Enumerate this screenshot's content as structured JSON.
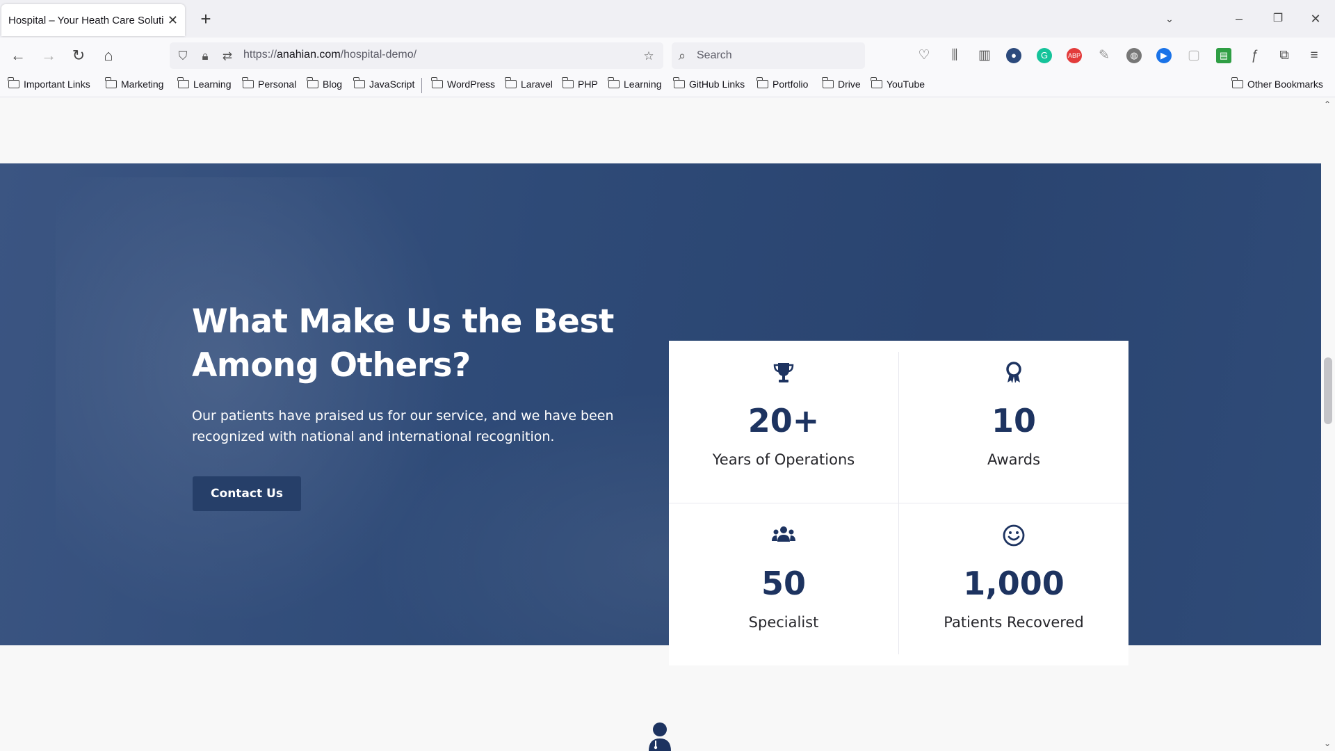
{
  "browser": {
    "tab_title": "Hospital – Your Heath Care Solution",
    "url_prefix": "https://",
    "url_domain": "anahian.com",
    "url_path": "/hospital-demo/",
    "search_placeholder": "Search",
    "bookmarks": [
      "Important Links",
      "Marketing",
      "Learning",
      "Personal",
      "Blog",
      "JavaScript",
      "WordPress",
      "Laravel",
      "PHP",
      "Learning",
      "GitHub Links",
      "Portfolio",
      "Drive",
      "YouTube"
    ],
    "other_bookmarks": "Other Bookmarks"
  },
  "hero": {
    "title": "What Make Us the Best Among Others?",
    "description": "Our patients have praised us for our service, and we have been recognized with national and international recognition.",
    "cta_label": "Contact Us"
  },
  "stats": [
    {
      "icon": "trophy-icon",
      "value": "20+",
      "label": "Years of Operations"
    },
    {
      "icon": "award-icon",
      "value": "10",
      "label": "Awards"
    },
    {
      "icon": "users-icon",
      "value": "50",
      "label": "Specialist"
    },
    {
      "icon": "smile-icon",
      "value": "1,000",
      "label": "Patients Recovered"
    }
  ],
  "colors": {
    "hero_bg": "#2e4a77",
    "accent_dark": "#1d3360",
    "button_bg": "#263f69"
  }
}
